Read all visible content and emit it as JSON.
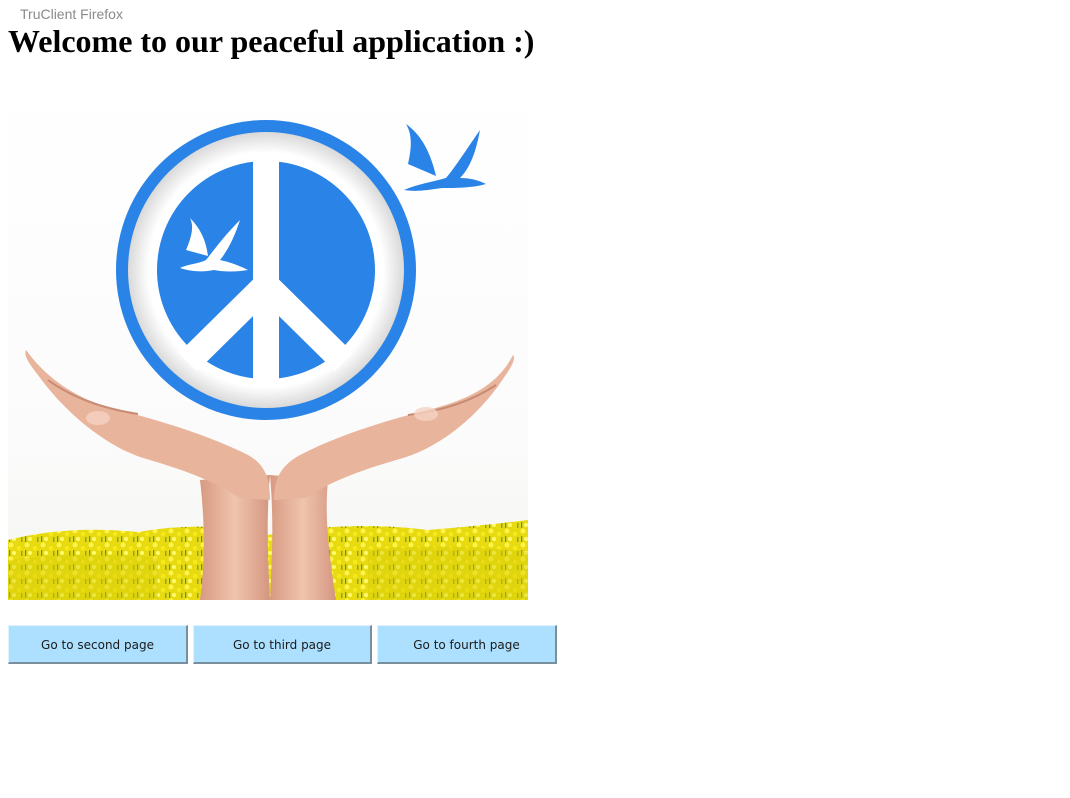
{
  "header": {
    "browser_label": "TruClient Firefox",
    "title": "Welcome to our peaceful application :)"
  },
  "hero": {
    "image_subject": "peace-sign-held-by-hands",
    "colors": {
      "peace_blue": "#2a83e6",
      "ring_white": "#ffffff",
      "skin": "#e9b7a0",
      "field_yellow": "#f2e600",
      "field_green": "#7fa12a"
    }
  },
  "nav": {
    "buttons": [
      {
        "label": "Go to second page"
      },
      {
        "label": "Go to third page"
      },
      {
        "label": "Go to fourth page"
      }
    ],
    "button_color": "#ade0ff"
  }
}
